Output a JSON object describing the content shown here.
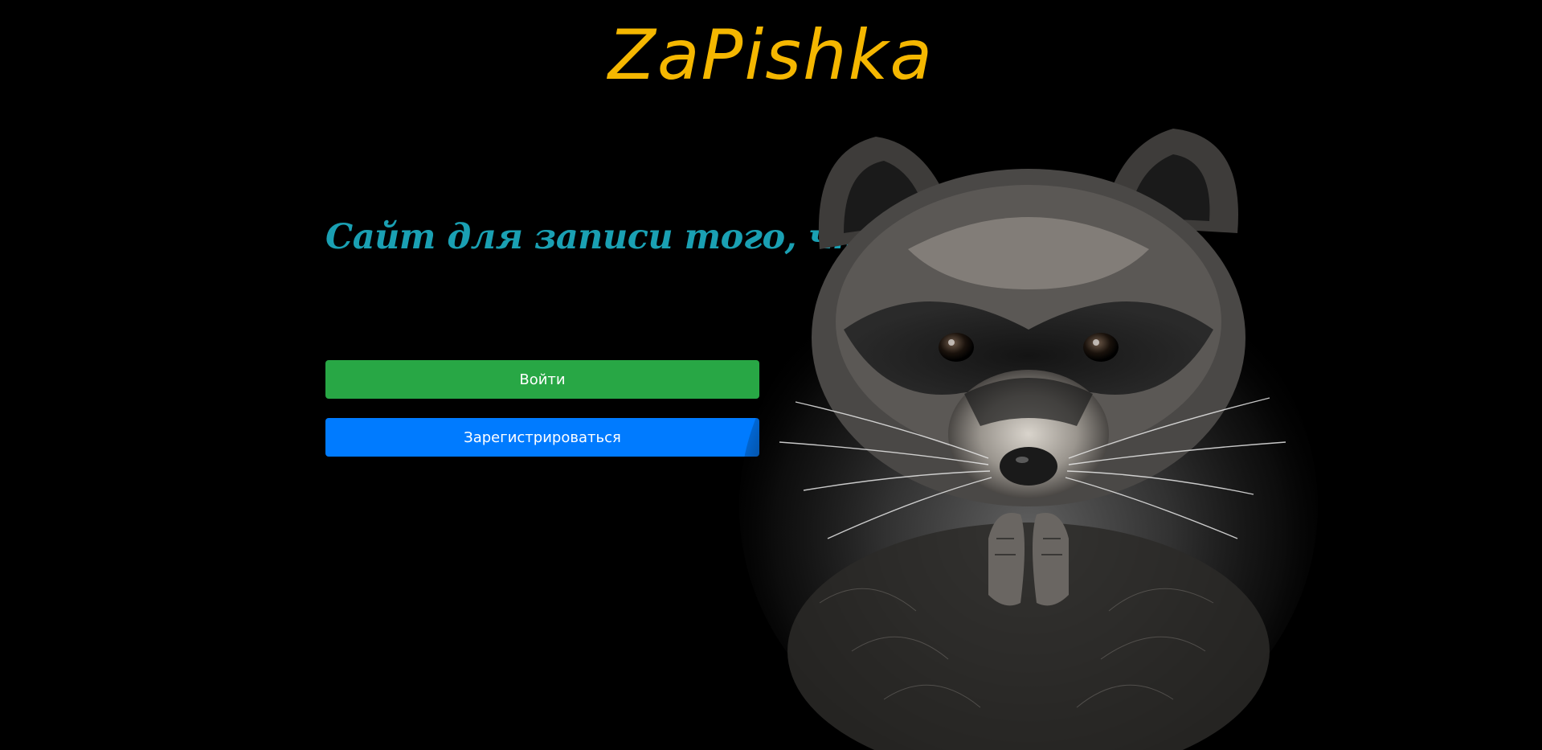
{
  "header": {
    "logo_text": "ZaPishka"
  },
  "main": {
    "tagline": "Сайт для записи того, что хочется",
    "login_label": "Войти",
    "register_label": "Зарегистрироваться"
  },
  "colors": {
    "background": "#000000",
    "logo": "#f5b700",
    "tagline": "#1aa0b3",
    "login_button": "#28a745",
    "register_button": "#007bff"
  },
  "hero_image": {
    "subject": "raccoon-photo"
  }
}
